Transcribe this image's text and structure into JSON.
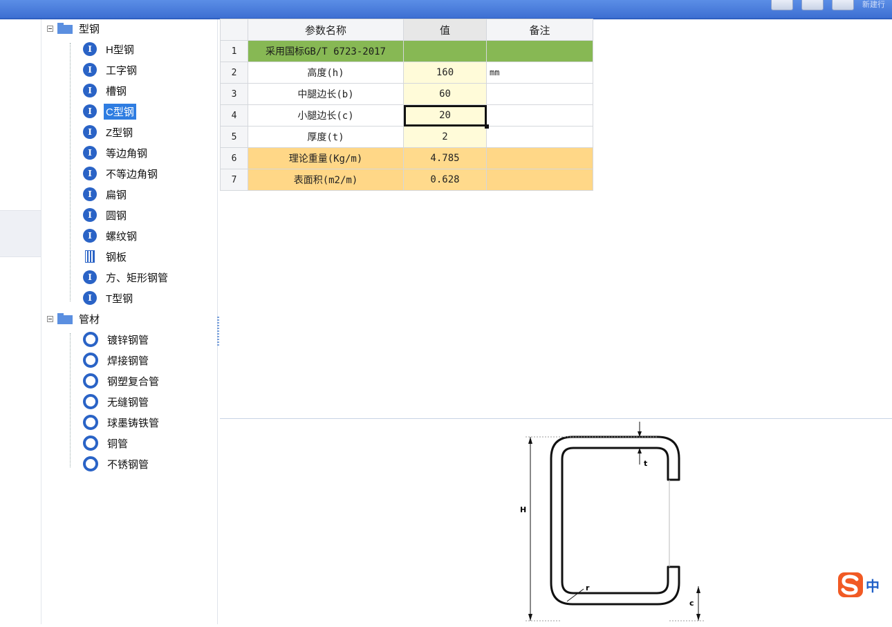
{
  "toolbar": {
    "partial_label": "新建行"
  },
  "tree": {
    "groups": [
      {
        "label": "型钢",
        "items": [
          "H型钢",
          "工字钢",
          "槽钢",
          "C型钢",
          "Z型钢",
          "等边角钢",
          "不等边角钢",
          "扁钢",
          "圆钢",
          "螺纹钢",
          "钢板",
          "方、矩形钢管",
          "T型钢"
        ],
        "selected": "C型钢"
      },
      {
        "label": "管材",
        "items": [
          "镀锌钢管",
          "焊接钢管",
          "钢塑复合管",
          "无缝钢管",
          "球墨铸铁管",
          "铜管",
          "不锈钢管"
        ]
      }
    ]
  },
  "table": {
    "headers": {
      "name": "参数名称",
      "value": "值",
      "note": "备注"
    },
    "rows": [
      {
        "no": "1",
        "name": "采用国标GB/T 6723-2017",
        "value": "",
        "note": ""
      },
      {
        "no": "2",
        "name": "高度(h)",
        "value": "160",
        "note": "mm"
      },
      {
        "no": "3",
        "name": "中腿边长(b)",
        "value": "60",
        "note": ""
      },
      {
        "no": "4",
        "name": "小腿边长(c)",
        "value": "20",
        "note": ""
      },
      {
        "no": "5",
        "name": "厚度(t)",
        "value": "2",
        "note": ""
      },
      {
        "no": "6",
        "name": "理论重量(Kg/m)",
        "value": "4.785",
        "note": ""
      },
      {
        "no": "7",
        "name": "表面积(m2/m)",
        "value": "0.628",
        "note": ""
      }
    ]
  },
  "figure": {
    "label_h": "H",
    "label_t": "t",
    "label_r": "r",
    "label_c": "c"
  },
  "ime": {
    "label": "中"
  },
  "colors": {
    "standard_row": "#87b854",
    "input_cell": "#fffbd9",
    "output_row": "#ffd787",
    "selection": "#2f7de1"
  }
}
